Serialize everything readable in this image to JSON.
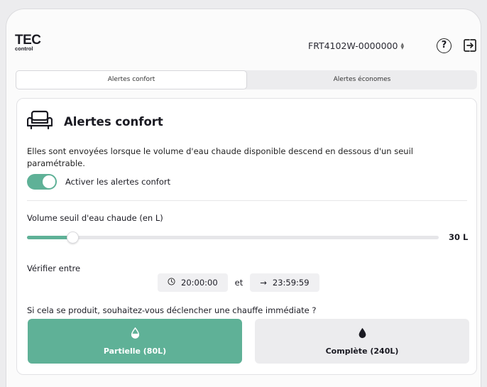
{
  "header": {
    "logo_main": "TEC",
    "logo_sub": "control",
    "device_id": "FRT4102W-0000000",
    "help_glyph": "?"
  },
  "tabs": [
    {
      "label": "Alertes confort",
      "active": true
    },
    {
      "label": "Alertes économes",
      "active": false
    }
  ],
  "card": {
    "icon": "armchair-icon",
    "title": "Alertes confort",
    "description": "Elles sont envoyées lorsque le volume d'eau chaude disponible descend en dessous d'un seuil paramétrable.",
    "toggle_label": "Activer les alertes confort",
    "toggle_on": true
  },
  "threshold": {
    "label": "Volume seuil d'eau chaude (en L)",
    "value_text": "30 L",
    "fraction": 0.11
  },
  "schedule": {
    "label": "Vérifier entre",
    "start": "20:00:00",
    "separator": "et",
    "end_arrow": "→",
    "end": "23:59:59"
  },
  "heating": {
    "question": "Si cela se produit, souhaitez-vous déclencher une chauffe immédiate ?",
    "options": [
      {
        "label": "Partielle (80L)",
        "icon": "half-drop-icon",
        "selected": true
      },
      {
        "label": "Complète (240L)",
        "icon": "drop-icon",
        "selected": false
      }
    ]
  },
  "colors": {
    "accent": "#5fb197",
    "muted_bg": "#ececee"
  }
}
